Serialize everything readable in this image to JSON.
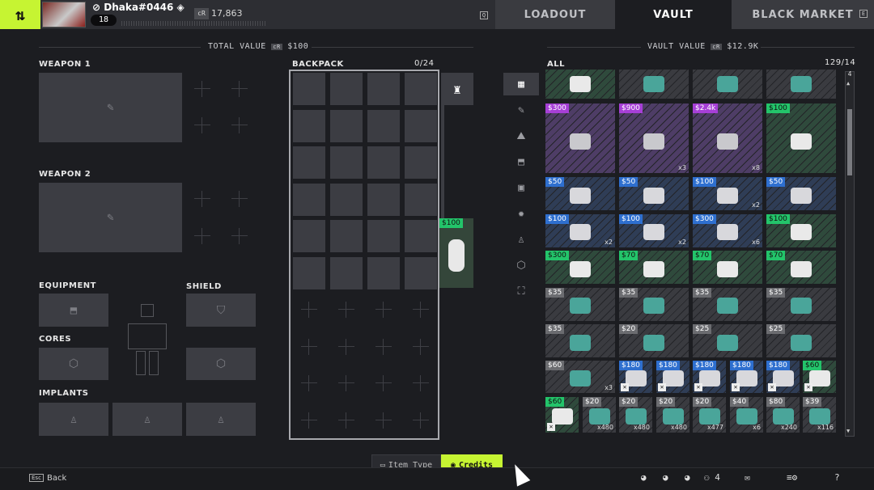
{
  "player": {
    "name": "Dhaka#0446",
    "level": "18",
    "credits": "17,863",
    "cr_label": "cR"
  },
  "tabs": [
    {
      "label": "LOADOUT",
      "key": "Q"
    },
    {
      "label": "VAULT"
    },
    {
      "label": "BLACK MARKET",
      "key": "E"
    }
  ],
  "loadout": {
    "total_value_label": "TOTAL VALUE",
    "total_value": "$100",
    "weapon1": "WEAPON 1",
    "weapon2": "WEAPON 2",
    "equipment": "EQUIPMENT",
    "shield": "SHIELD",
    "cores": "CORES",
    "implants": "IMPLANTS"
  },
  "backpack": {
    "label": "BACKPACK",
    "count": "0/24",
    "side_item_price": "$100"
  },
  "vault": {
    "label": "VAULT VALUE",
    "value": "$12.9K",
    "filter": "ALL",
    "count": "129/14",
    "scroll_key": "4"
  },
  "vault_rows": [
    [
      {
        "p": "",
        "c": "g"
      },
      {
        "p": "",
        "c": "n"
      },
      {
        "p": "",
        "c": "n"
      },
      {
        "p": "",
        "c": "n"
      }
    ],
    [
      {
        "p": "$300",
        "c": "v"
      },
      {
        "p": "$900",
        "c": "v",
        "q": "x3"
      },
      {
        "p": "$2.4k",
        "c": "v",
        "q": "x8"
      },
      {
        "p": "$100",
        "c": "g"
      }
    ],
    [
      {
        "p": "$50",
        "c": "b"
      },
      {
        "p": "$50",
        "c": "b"
      },
      {
        "p": "$100",
        "c": "b",
        "q": "x2"
      },
      {
        "p": "$50",
        "c": "b"
      }
    ],
    [
      {
        "p": "$100",
        "c": "b",
        "q": "x2"
      },
      {
        "p": "$100",
        "c": "b",
        "q": "x2"
      },
      {
        "p": "$300",
        "c": "b",
        "q": "x6"
      },
      {
        "p": "$100",
        "c": "g"
      }
    ],
    [
      {
        "p": "$300",
        "c": "g"
      },
      {
        "p": "$70",
        "c": "g"
      },
      {
        "p": "$70",
        "c": "g"
      },
      {
        "p": "$70",
        "c": "g"
      }
    ],
    [
      {
        "p": "$35",
        "c": "n"
      },
      {
        "p": "$35",
        "c": "n"
      },
      {
        "p": "$35",
        "c": "n"
      },
      {
        "p": "$35",
        "c": "n"
      }
    ],
    [
      {
        "p": "$35",
        "c": "n"
      },
      {
        "p": "$20",
        "c": "n"
      },
      {
        "p": "$25",
        "c": "n"
      },
      {
        "p": "$25",
        "c": "n"
      }
    ]
  ],
  "vault_small_row1": [
    {
      "p": "$60",
      "c": "n",
      "q": "x3"
    },
    {
      "p": "$180",
      "c": "b",
      "x": true
    },
    {
      "p": "$180",
      "c": "b",
      "x": true
    },
    {
      "p": "$180",
      "c": "b",
      "x": true
    },
    {
      "p": "$180",
      "c": "b",
      "x": true
    },
    {
      "p": "$180",
      "c": "b",
      "x": true
    },
    {
      "p": "$60",
      "c": "g",
      "x": true
    }
  ],
  "vault_small_row2": [
    {
      "p": "$60",
      "c": "g",
      "x": true
    },
    {
      "p": "$20",
      "c": "n",
      "q": "x480"
    },
    {
      "p": "$20",
      "c": "n",
      "q": "x480"
    },
    {
      "p": "$20",
      "c": "n",
      "q": "x480"
    },
    {
      "p": "$20",
      "c": "n",
      "q": "x477"
    },
    {
      "p": "$40",
      "c": "n",
      "q": "x6"
    },
    {
      "p": "$80",
      "c": "n",
      "q": "x240"
    },
    {
      "p": "$39",
      "c": "n",
      "q": "x116"
    }
  ],
  "bottom": {
    "back_key": "Esc",
    "back": "Back",
    "item_type": "Item Type",
    "credits": "Credits",
    "squad_count": "4",
    "help": "?"
  },
  "colors": {
    "accent": "#c6f432",
    "blue": "#2e6fcf",
    "purple": "#a63fd6",
    "green": "#23c46a",
    "neutral": "#6b6c70"
  }
}
